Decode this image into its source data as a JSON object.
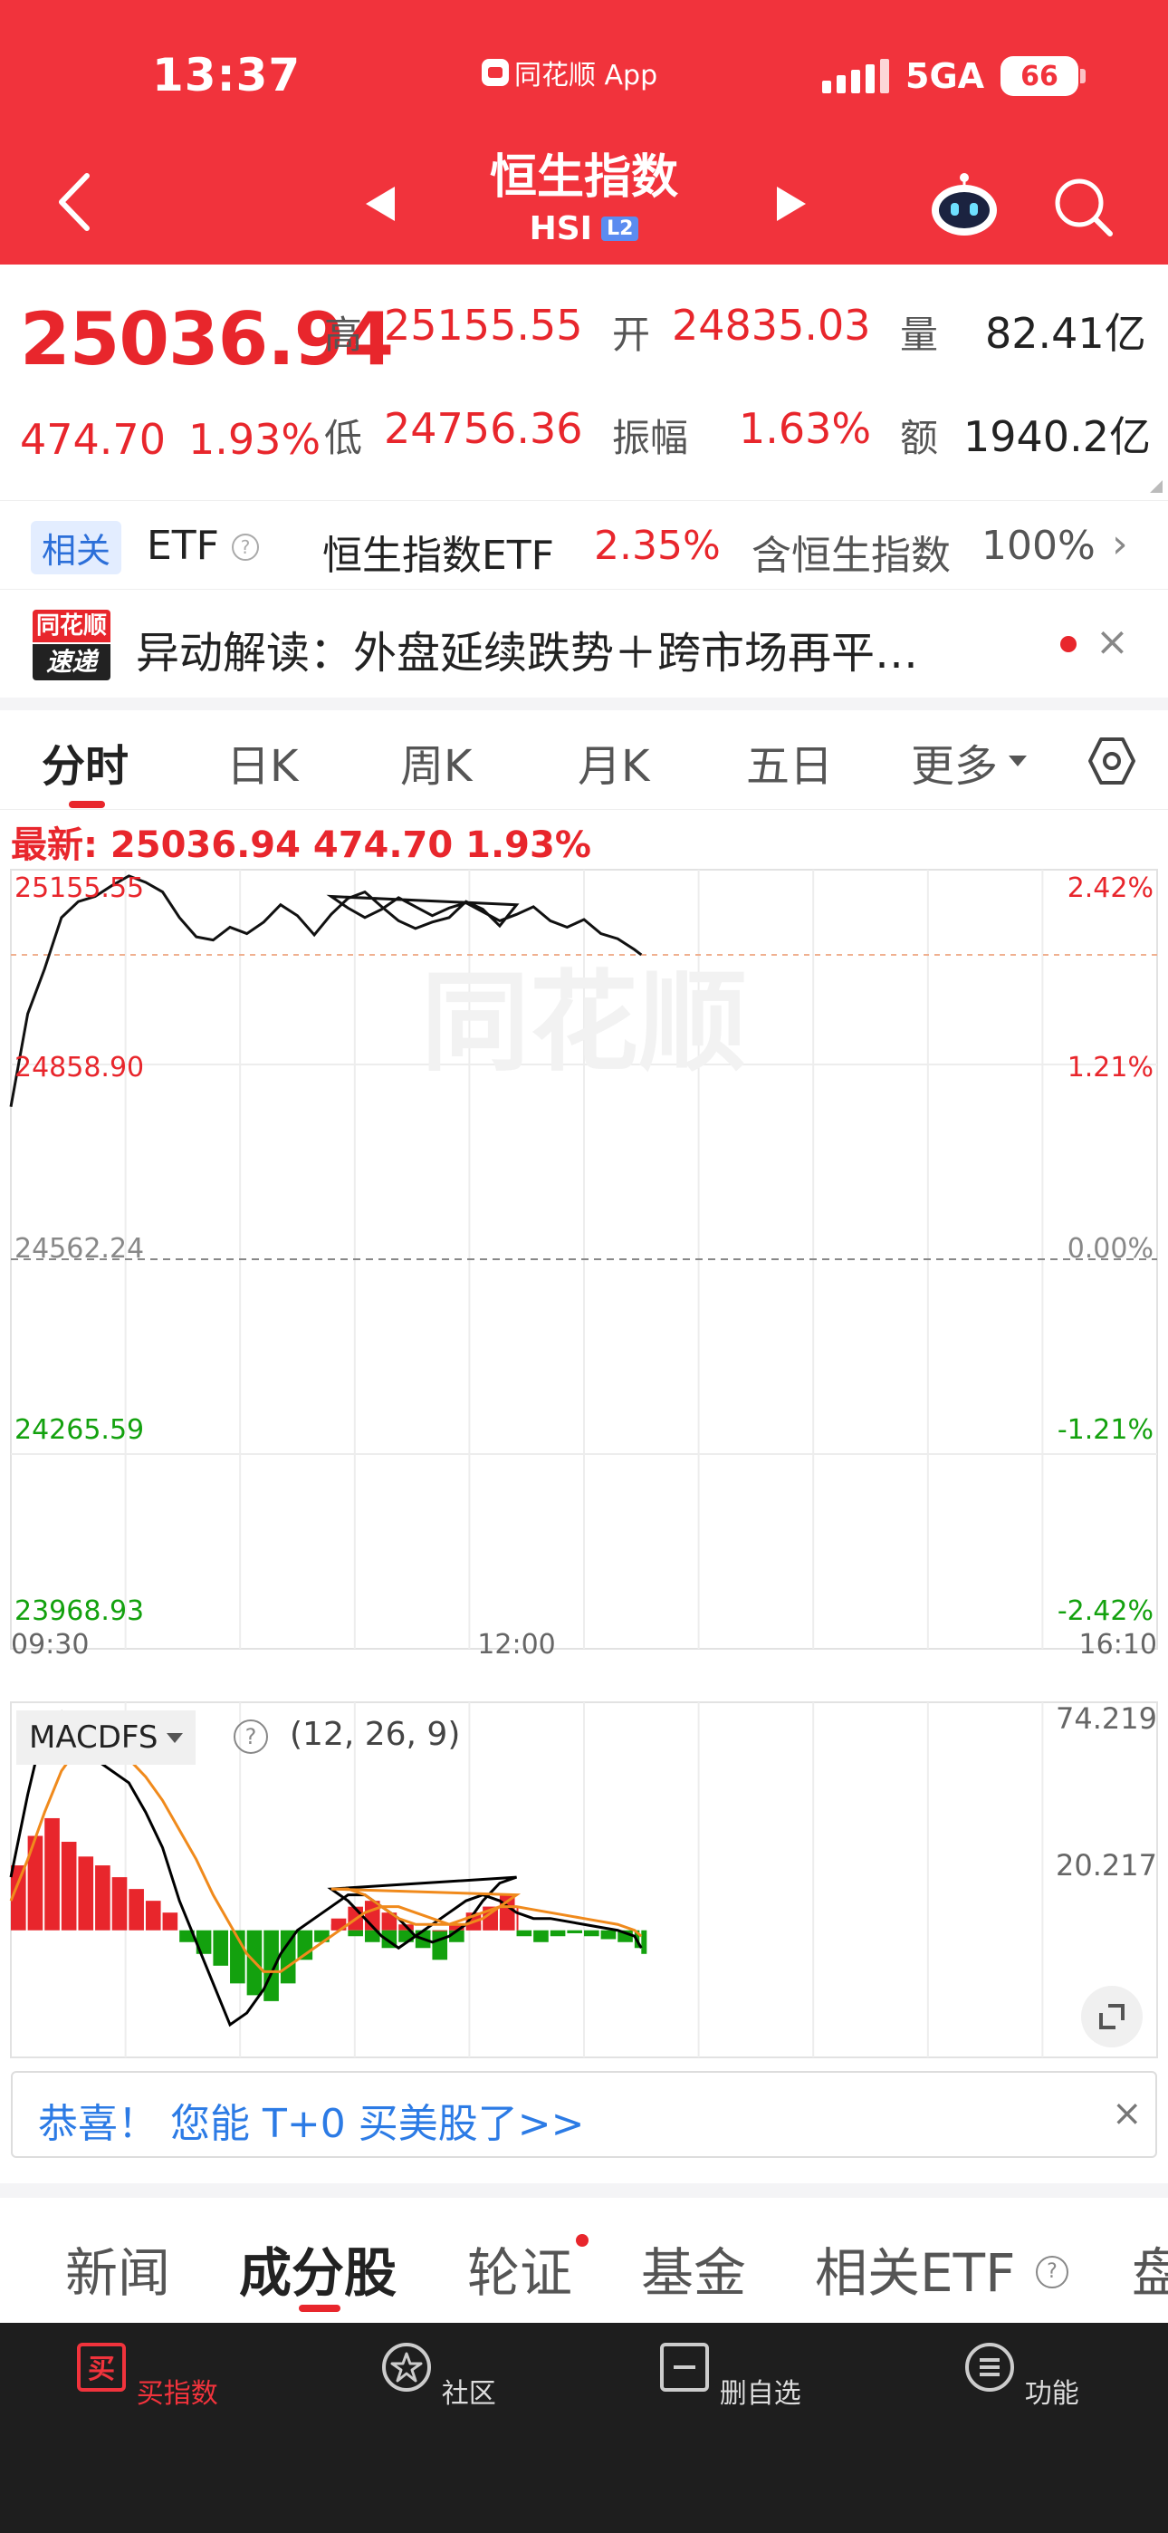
{
  "status_bar": {
    "time": "13:37",
    "app_label": "同花顺 App",
    "network": "5GA",
    "battery": "66"
  },
  "header": {
    "title": "恒生指数",
    "code": "HSI",
    "level_badge": "L2"
  },
  "quote": {
    "last_price": "25036.94",
    "change_points": "474.70",
    "change_percent": "1.93%",
    "high_label": "高",
    "high": "25155.55",
    "open_label": "开",
    "open": "24835.03",
    "volume_label": "量",
    "volume": "82.41亿",
    "low_label": "低",
    "low": "24756.36",
    "amplitude_label": "振幅",
    "amplitude": "1.63%",
    "amount_label": "额",
    "amount": "1940.2亿"
  },
  "etf_row": {
    "tag": "相关",
    "label": "ETF",
    "help": "?",
    "name": "恒生指数ETF",
    "pct": "2.35%",
    "holding_label": "含恒生指数",
    "holding_pct": "100%",
    "arrow": "›"
  },
  "ticker": {
    "logo_top": "同花顺",
    "logo_bottom": "速递",
    "text": "异动解读：外盘延续跌势＋跨市场再平…",
    "close": "×"
  },
  "chart_tabs": [
    "分时",
    "日K",
    "周K",
    "月K",
    "五日",
    "更多"
  ],
  "latest": "最新: 25036.94  474.70  1.93%",
  "price_chart": {
    "left_ticks": [
      "25155.55",
      "24858.90",
      "24562.24",
      "24265.59",
      "23968.93"
    ],
    "right_ticks": [
      "2.42%",
      "1.21%",
      "0.00%",
      "-1.21%",
      "-2.42%"
    ],
    "time_ticks": [
      "09:30",
      "12:00",
      "16:10"
    ],
    "watermark": "同花顺"
  },
  "macd": {
    "name": "MACDFS",
    "help": "?",
    "params": "(12, 26, 9)",
    "top_value": "74.219",
    "mid_value": "20.217"
  },
  "promo": {
    "text": "恭喜！ 您能 T+0 买美股了>>",
    "close": "×"
  },
  "sub_tabs": [
    "新闻",
    "成分股",
    "轮证",
    "基金",
    "相关ETF",
    "盘"
  ],
  "bottom_nav": [
    {
      "label": "买指数",
      "icon": "buy-icon"
    },
    {
      "label": "社区",
      "icon": "community-icon"
    },
    {
      "label": "删自选",
      "icon": "remove-watchlist-icon"
    },
    {
      "label": "功能",
      "icon": "menu-icon"
    }
  ],
  "colors": {
    "brand_red": "#f1333c",
    "up": "#e8262c",
    "down": "#13a10e",
    "dif": "#000000",
    "dea": "#f08a1c"
  },
  "chart_data": [
    {
      "type": "line",
      "title": "",
      "x_range": [
        "09:30",
        "16:10"
      ],
      "ylim": [
        23968.93,
        25155.55
      ],
      "reference": 24562.24,
      "series": [
        {
          "x": [
            "09:30",
            "09:35",
            "09:40",
            "09:45",
            "09:50",
            "09:55",
            "10:00",
            "10:05",
            "10:10",
            "10:15",
            "10:20",
            "10:25",
            "10:30",
            "10:35",
            "10:40",
            "10:45",
            "10:50",
            "10:55",
            "11:00",
            "11:05",
            "11:10",
            "11:15",
            "11:20",
            "11:25",
            "11:30",
            "11:35",
            "11:40",
            "11:45",
            "11:50",
            "11:55",
            "12:00",
            "12:05",
            "12:10",
            "12:15",
            "12:20",
            "12:25",
            "12:30",
            "12:35",
            "12:40",
            "12:45",
            "12:50",
            "12:55",
            "13:00",
            "13:05",
            "13:10",
            "13:15",
            "13:20",
            "13:25",
            "13:30",
            "13:35",
            "13:37"
          ],
          "values": [
            24800,
            24945,
            25015,
            25095,
            25120,
            25128,
            25145,
            25160,
            25150,
            25135,
            25095,
            25065,
            25060,
            25080,
            25070,
            25088,
            25115,
            25098,
            25068,
            25100,
            25125,
            25135,
            25112,
            25090,
            25078,
            25088,
            25095,
            25120,
            25108,
            25082,
            25115,
            25128,
            25110,
            25095,
            25108,
            25126,
            25112,
            25098,
            25110,
            25118,
            25104,
            25090,
            25100,
            25112,
            25090,
            25080,
            25092,
            25070,
            25062,
            25045,
            25036.94
          ]
        }
      ]
    },
    {
      "type": "bar",
      "title": "MACDFS",
      "ylim": [
        -40,
        74.219
      ],
      "series": [
        {
          "name": "MACD",
          "values": [
            22,
            32,
            38,
            30,
            25,
            22,
            18,
            14,
            10,
            6,
            -4,
            -8,
            -12,
            -18,
            -22,
            -24,
            -18,
            -10,
            -4,
            4,
            8,
            10,
            6,
            2,
            -6,
            -10,
            -4,
            2,
            8,
            12,
            8,
            2,
            -2,
            -4,
            -6,
            -4,
            -2,
            0,
            2,
            6,
            8,
            4,
            -2,
            -4,
            -2,
            -1,
            -2,
            -3,
            -4,
            -6,
            -8
          ]
        },
        {
          "name": "DIF",
          "values": [
            18,
            46,
            70,
            74,
            66,
            58,
            54,
            50,
            40,
            28,
            10,
            -4,
            -18,
            -32,
            -28,
            -20,
            -8,
            0,
            4,
            8,
            12,
            12,
            8,
            4,
            -2,
            -4,
            -2,
            2,
            10,
            16,
            18,
            14,
            10,
            4,
            -2,
            -6,
            -2,
            2,
            6,
            10,
            12,
            10,
            6,
            4,
            4,
            3,
            2,
            1,
            0,
            -2,
            -6
          ]
        },
        {
          "name": "DEA",
          "values": [
            10,
            24,
            40,
            54,
            62,
            64,
            62,
            58,
            52,
            44,
            34,
            24,
            12,
            2,
            -8,
            -14,
            -14,
            -10,
            -6,
            -2,
            2,
            6,
            8,
            8,
            6,
            4,
            2,
            2,
            4,
            8,
            12,
            14,
            14,
            12,
            8,
            4,
            2,
            2,
            2,
            4,
            6,
            8,
            8,
            7,
            6,
            5,
            4,
            3,
            2,
            0,
            -2
          ]
        }
      ]
    }
  ]
}
